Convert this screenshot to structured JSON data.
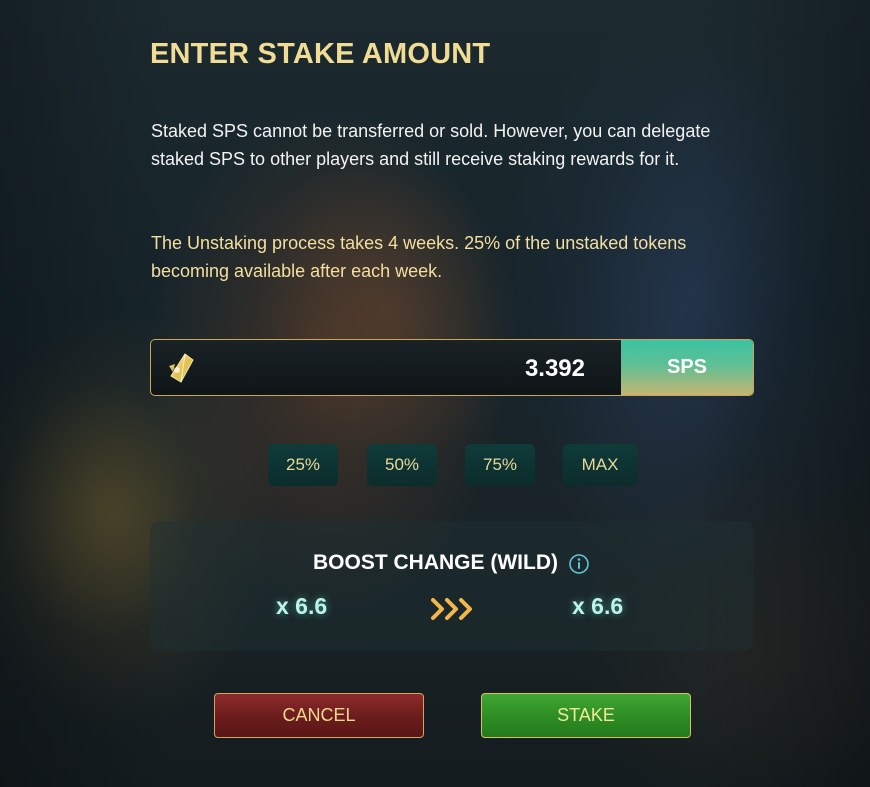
{
  "title": "ENTER STAKE AMOUNT",
  "description": "Staked SPS cannot be transferred or sold. However, you can delegate staked SPS to other players and still receive staking rewards for it.",
  "unstake_note": "The Unstaking process takes 4 weeks. 25% of the unstaked tokens becoming available after each week.",
  "amount": {
    "value": "3.392",
    "unit": "SPS",
    "icon": "sps-token-icon"
  },
  "percent_buttons": [
    "25%",
    "50%",
    "75%",
    "MAX"
  ],
  "boost": {
    "title": "BOOST CHANGE (WILD)",
    "from": "x 6.6",
    "to": "x 6.6",
    "info_icon": "info-icon",
    "arrow_icon": "triple-chevron-right-icon"
  },
  "buttons": {
    "cancel": "CANCEL",
    "stake": "STAKE"
  },
  "colors": {
    "title_gold": "#f1dc96",
    "note_gold": "#f3dfa0",
    "sps_teal": "#3cc3a3",
    "boost_glow": "#bff3e9",
    "cancel_red": "#8d2b2b",
    "stake_green": "#3fa733"
  }
}
